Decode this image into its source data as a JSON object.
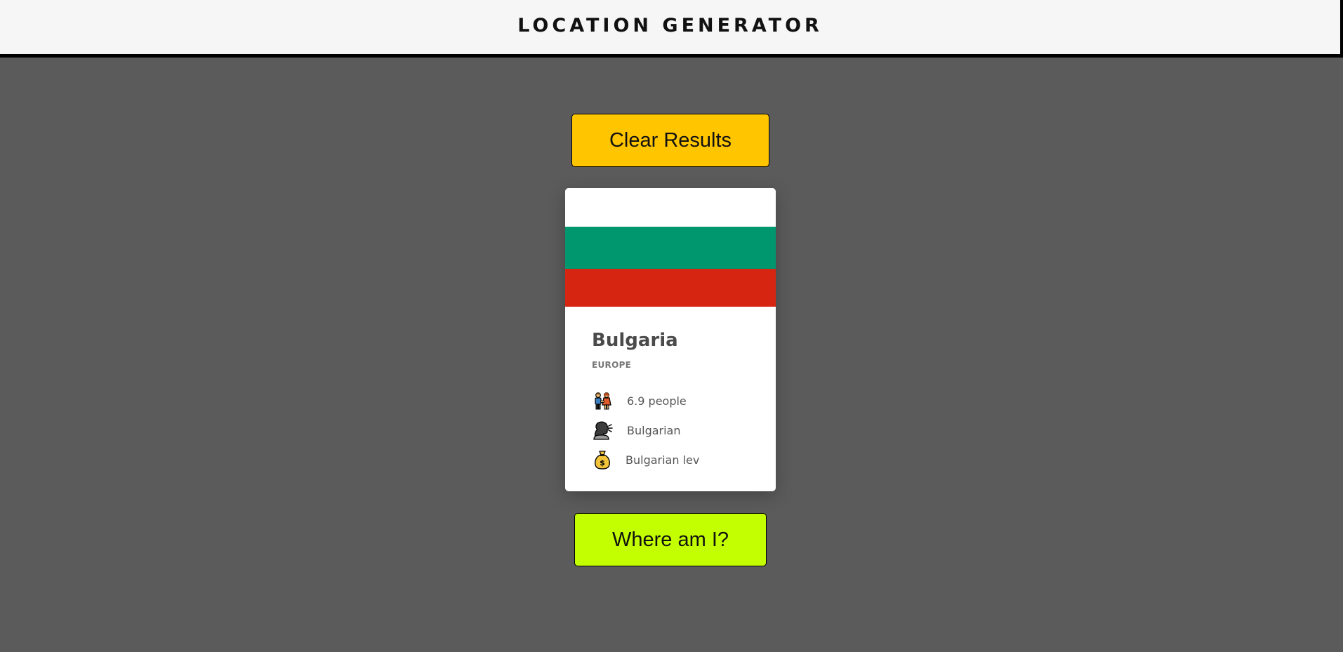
{
  "header": {
    "title": "LOCATION GENERATOR"
  },
  "actions": {
    "clear_label": "Clear Results",
    "where_label": "Where am I?"
  },
  "card": {
    "flag_colors": [
      "#ffffff",
      "#00966e",
      "#d62612"
    ],
    "country": "Bulgaria",
    "region": "EUROPE",
    "population": "6.9 people",
    "language": "Bulgarian",
    "currency": "Bulgarian lev",
    "icons": {
      "population": "people-icon",
      "language": "speaking-head-icon",
      "currency": "money-bag-icon"
    }
  },
  "colors": {
    "background": "#5b5b5b",
    "header_bg": "#f6f6f6",
    "clear_button": "#ffc600",
    "where_button": "#c3ff00"
  }
}
